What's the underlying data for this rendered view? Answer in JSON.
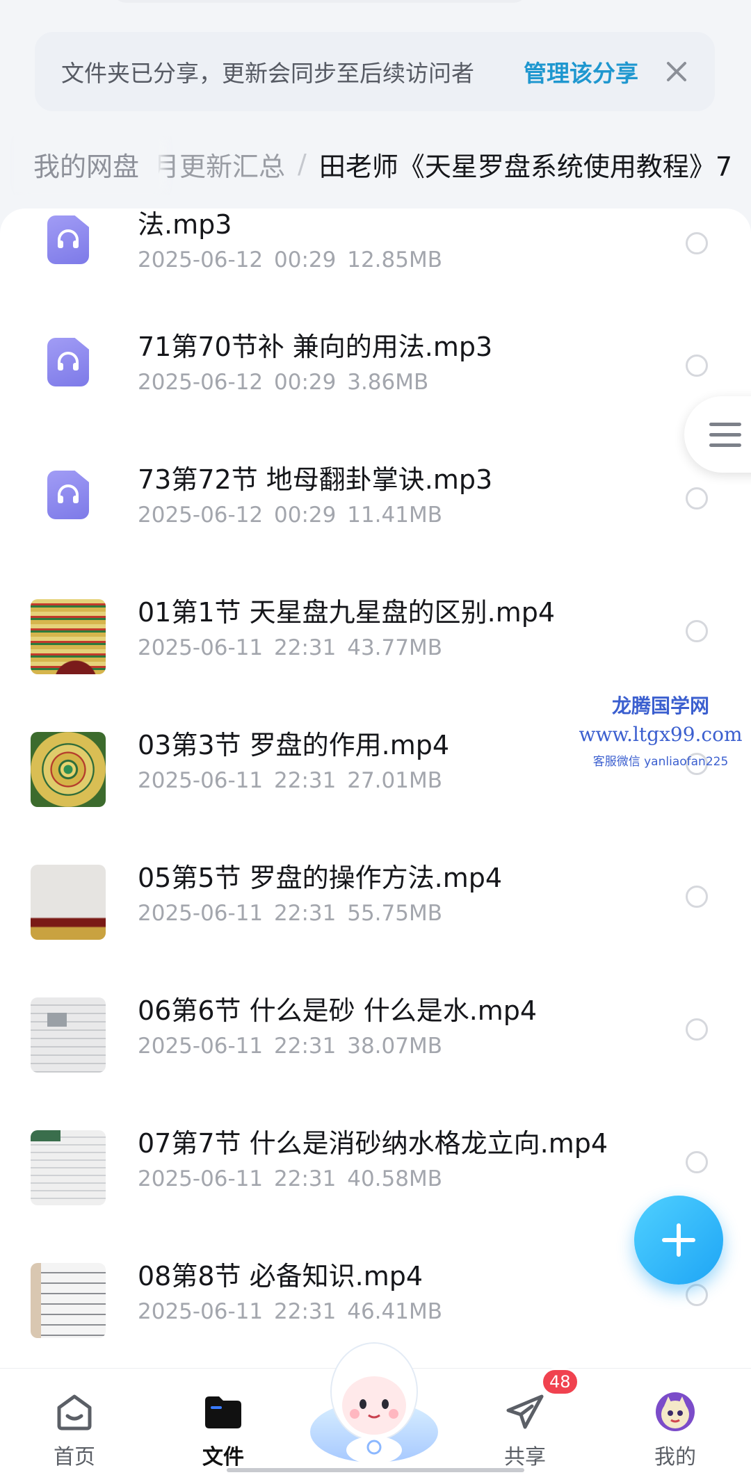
{
  "share_banner": {
    "message": "文件夹已分享，更新会同步至后续访问者",
    "manage_label": "管理该分享",
    "close_icon": "close-icon"
  },
  "breadcrumb": {
    "root": "我的网盘",
    "middle": "月更新汇总",
    "separator": "/",
    "current": "田老师《天星罗盘系统使用教程》7"
  },
  "files": [
    {
      "name": "法.mp3",
      "date": "2025-06-12",
      "time": "00:29",
      "size": "12.85MB",
      "type": "audio"
    },
    {
      "name": "71第70节补 兼向的用法.mp3",
      "date": "2025-06-12",
      "time": "00:29",
      "size": "3.86MB",
      "type": "audio"
    },
    {
      "name": "73第72节 地母翻卦掌诀.mp3",
      "date": "2025-06-12",
      "time": "00:29",
      "size": "11.41MB",
      "type": "audio"
    },
    {
      "name": "01第1节 天星盘九星盘的区别.mp4",
      "date": "2025-06-11",
      "time": "22:31",
      "size": "43.77MB",
      "type": "video"
    },
    {
      "name": "03第3节 罗盘的作用.mp4",
      "date": "2025-06-11",
      "time": "22:31",
      "size": "27.01MB",
      "type": "video"
    },
    {
      "name": "05第5节 罗盘的操作方法.mp4",
      "date": "2025-06-11",
      "time": "22:31",
      "size": "55.75MB",
      "type": "video"
    },
    {
      "name": "06第6节 什么是砂 什么是水.mp4",
      "date": "2025-06-11",
      "time": "22:31",
      "size": "38.07MB",
      "type": "video"
    },
    {
      "name": "07第7节 什么是消砂纳水格龙立向.mp4",
      "date": "2025-06-11",
      "time": "22:31",
      "size": "40.58MB",
      "type": "video"
    },
    {
      "name": "08第8节 必备知识.mp4",
      "date": "2025-06-11",
      "time": "22:31",
      "size": "46.41MB",
      "type": "video"
    }
  ],
  "watermark": {
    "line1": "龙腾国学网",
    "line2": "www.ltgx99.com",
    "line3": "客服微信 yanliaofan225"
  },
  "tabbar": {
    "home": "首页",
    "files": "文件",
    "share": "共享",
    "share_badge": "48",
    "mine": "我的"
  },
  "colors": {
    "accent": "#1f97cf",
    "fab": "#1ea5f5",
    "badge": "#f0424f",
    "audio_icon": "#8f8bf0"
  }
}
